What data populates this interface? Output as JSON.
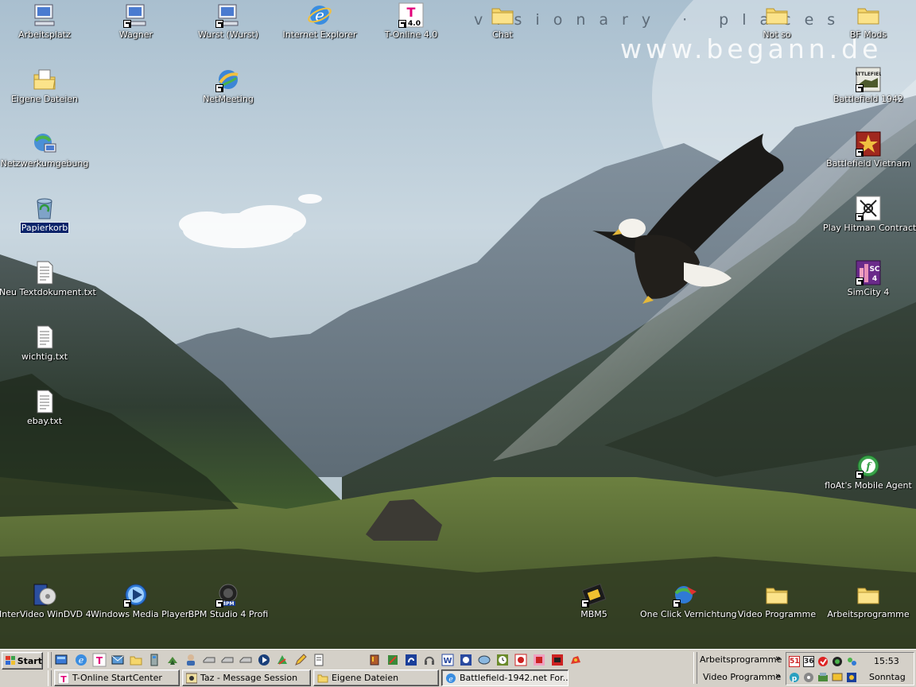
{
  "wallpaper": {
    "tagline": "visionary · places",
    "url": "www.begann.de"
  },
  "desktop_icons": [
    {
      "label": "Arbeitsplatz",
      "icon": "my-computer-icon"
    },
    {
      "label": "Wagner",
      "icon": "computer-shortcut-icon"
    },
    {
      "label": "Wurst (Wurst)",
      "icon": "computer-shortcut-icon"
    },
    {
      "label": "Internet Explorer",
      "icon": "internet-explorer-icon"
    },
    {
      "label": "T-Online 4.0",
      "icon": "t-online-icon"
    },
    {
      "label": "Chat",
      "icon": "folder-icon"
    },
    {
      "label": "Not so",
      "icon": "folder-icon"
    },
    {
      "label": "BF Mods",
      "icon": "folder-icon"
    },
    {
      "label": "Eigene Dateien",
      "icon": "my-documents-icon"
    },
    {
      "label": "NetMeeting",
      "icon": "netmeeting-icon"
    },
    {
      "label": "Battlefield 1942",
      "icon": "battlefield-1942-icon"
    },
    {
      "label": "Netzwerkumgebung",
      "icon": "network-places-icon"
    },
    {
      "label": "Battlefield Vietnam",
      "icon": "battlefield-vietnam-icon"
    },
    {
      "label": "Papierkorb",
      "icon": "recycle-bin-icon"
    },
    {
      "label": "Play Hitman Contracts",
      "icon": "hitman-icon"
    },
    {
      "label": "Neu Textdokument.txt",
      "icon": "text-file-icon"
    },
    {
      "label": "SimCity 4",
      "icon": "simcity-icon"
    },
    {
      "label": "wichtig.txt",
      "icon": "text-file-icon"
    },
    {
      "label": "ebay.txt",
      "icon": "text-file-icon"
    },
    {
      "label": "floAt's Mobile Agent",
      "icon": "mobile-agent-icon"
    },
    {
      "label": "InterVideo WinDVD 4",
      "icon": "windvd-icon"
    },
    {
      "label": "Windows Media Player",
      "icon": "media-player-icon"
    },
    {
      "label": "BPM Studio 4 Profi",
      "icon": "bpm-studio-icon"
    },
    {
      "label": "MBM5",
      "icon": "mbm5-icon"
    },
    {
      "label": "One Click Vernichtung",
      "icon": "one-click-icon"
    },
    {
      "label": "Video Programme",
      "icon": "folder-icon"
    },
    {
      "label": "Arbeitsprogramme",
      "icon": "folder-icon"
    }
  ],
  "taskbar": {
    "start_label": "Start",
    "quick_launch": [
      "show-desktop-icon",
      "internet-explorer-icon",
      "t-online-icon",
      "outlook-icon",
      "folder-icon",
      "network-icon",
      "user-icon",
      "drive-icon",
      "drive-icon",
      "drive-icon",
      "media-icon",
      "netscape-icon",
      "pencil-icon",
      "text-icon",
      "paint-icon",
      "tools-icon",
      "music-icon",
      "headphones-icon",
      "word-icon",
      "app-icon",
      "app-icon",
      "clock-icon",
      "app-icon",
      "app-icon",
      "app-icon",
      "app-icon"
    ],
    "tasks": [
      {
        "label": "T-Online StartCenter",
        "icon": "t-online-icon"
      },
      {
        "label": "Taz - Message Session",
        "icon": "messenger-icon"
      },
      {
        "label": "Eigene Dateien",
        "icon": "folder-icon"
      },
      {
        "label": "Battlefield-1942.net For...",
        "icon": "internet-explorer-icon"
      }
    ],
    "toolbars": [
      "Arbeitsprogramme",
      "Video Programme"
    ],
    "chevron": "»",
    "tray": {
      "badges": [
        "51",
        "36"
      ],
      "time": "15:53",
      "day": "Sonntag"
    }
  }
}
